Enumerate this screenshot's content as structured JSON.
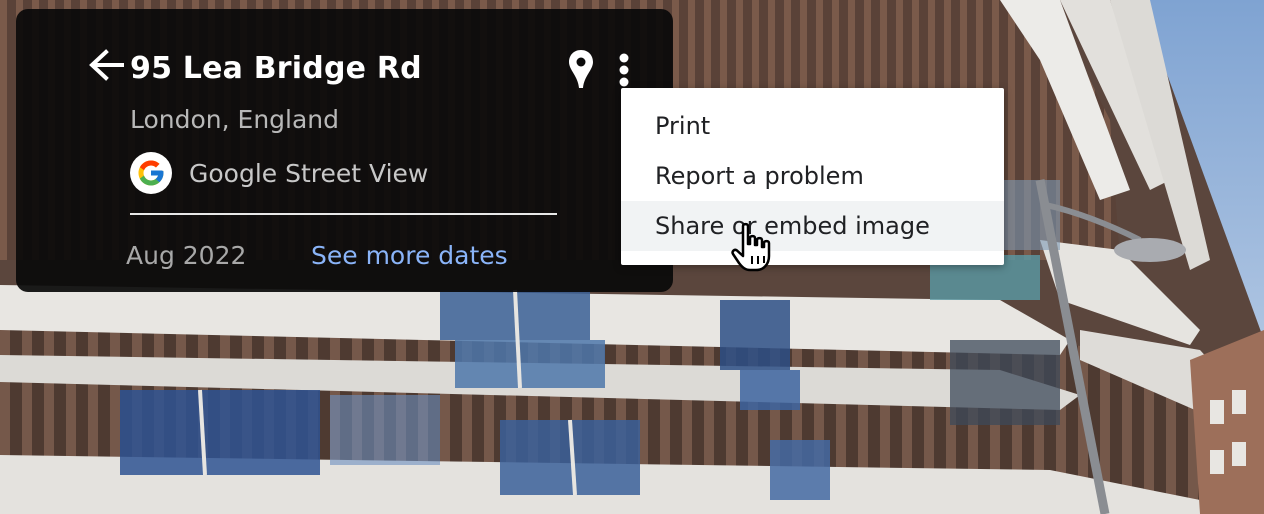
{
  "info_card": {
    "title": "95 Lea Bridge Rd",
    "subtitle": "London, England",
    "provider": "Google Street View",
    "date": "Aug 2022",
    "more_dates_label": "See more dates",
    "icons": {
      "back": "arrow-back-icon",
      "pin": "map-pin-icon",
      "more": "more-vert-icon",
      "provider_logo": "google-g-logo"
    }
  },
  "menu": {
    "items": [
      {
        "label": "Print"
      },
      {
        "label": "Report a problem"
      },
      {
        "label": "Share or embed image",
        "hovered": true
      }
    ]
  },
  "colors": {
    "card_bg": "#0a0a0a",
    "link": "#8ab4f8",
    "menu_hover": "#f1f3f4"
  }
}
